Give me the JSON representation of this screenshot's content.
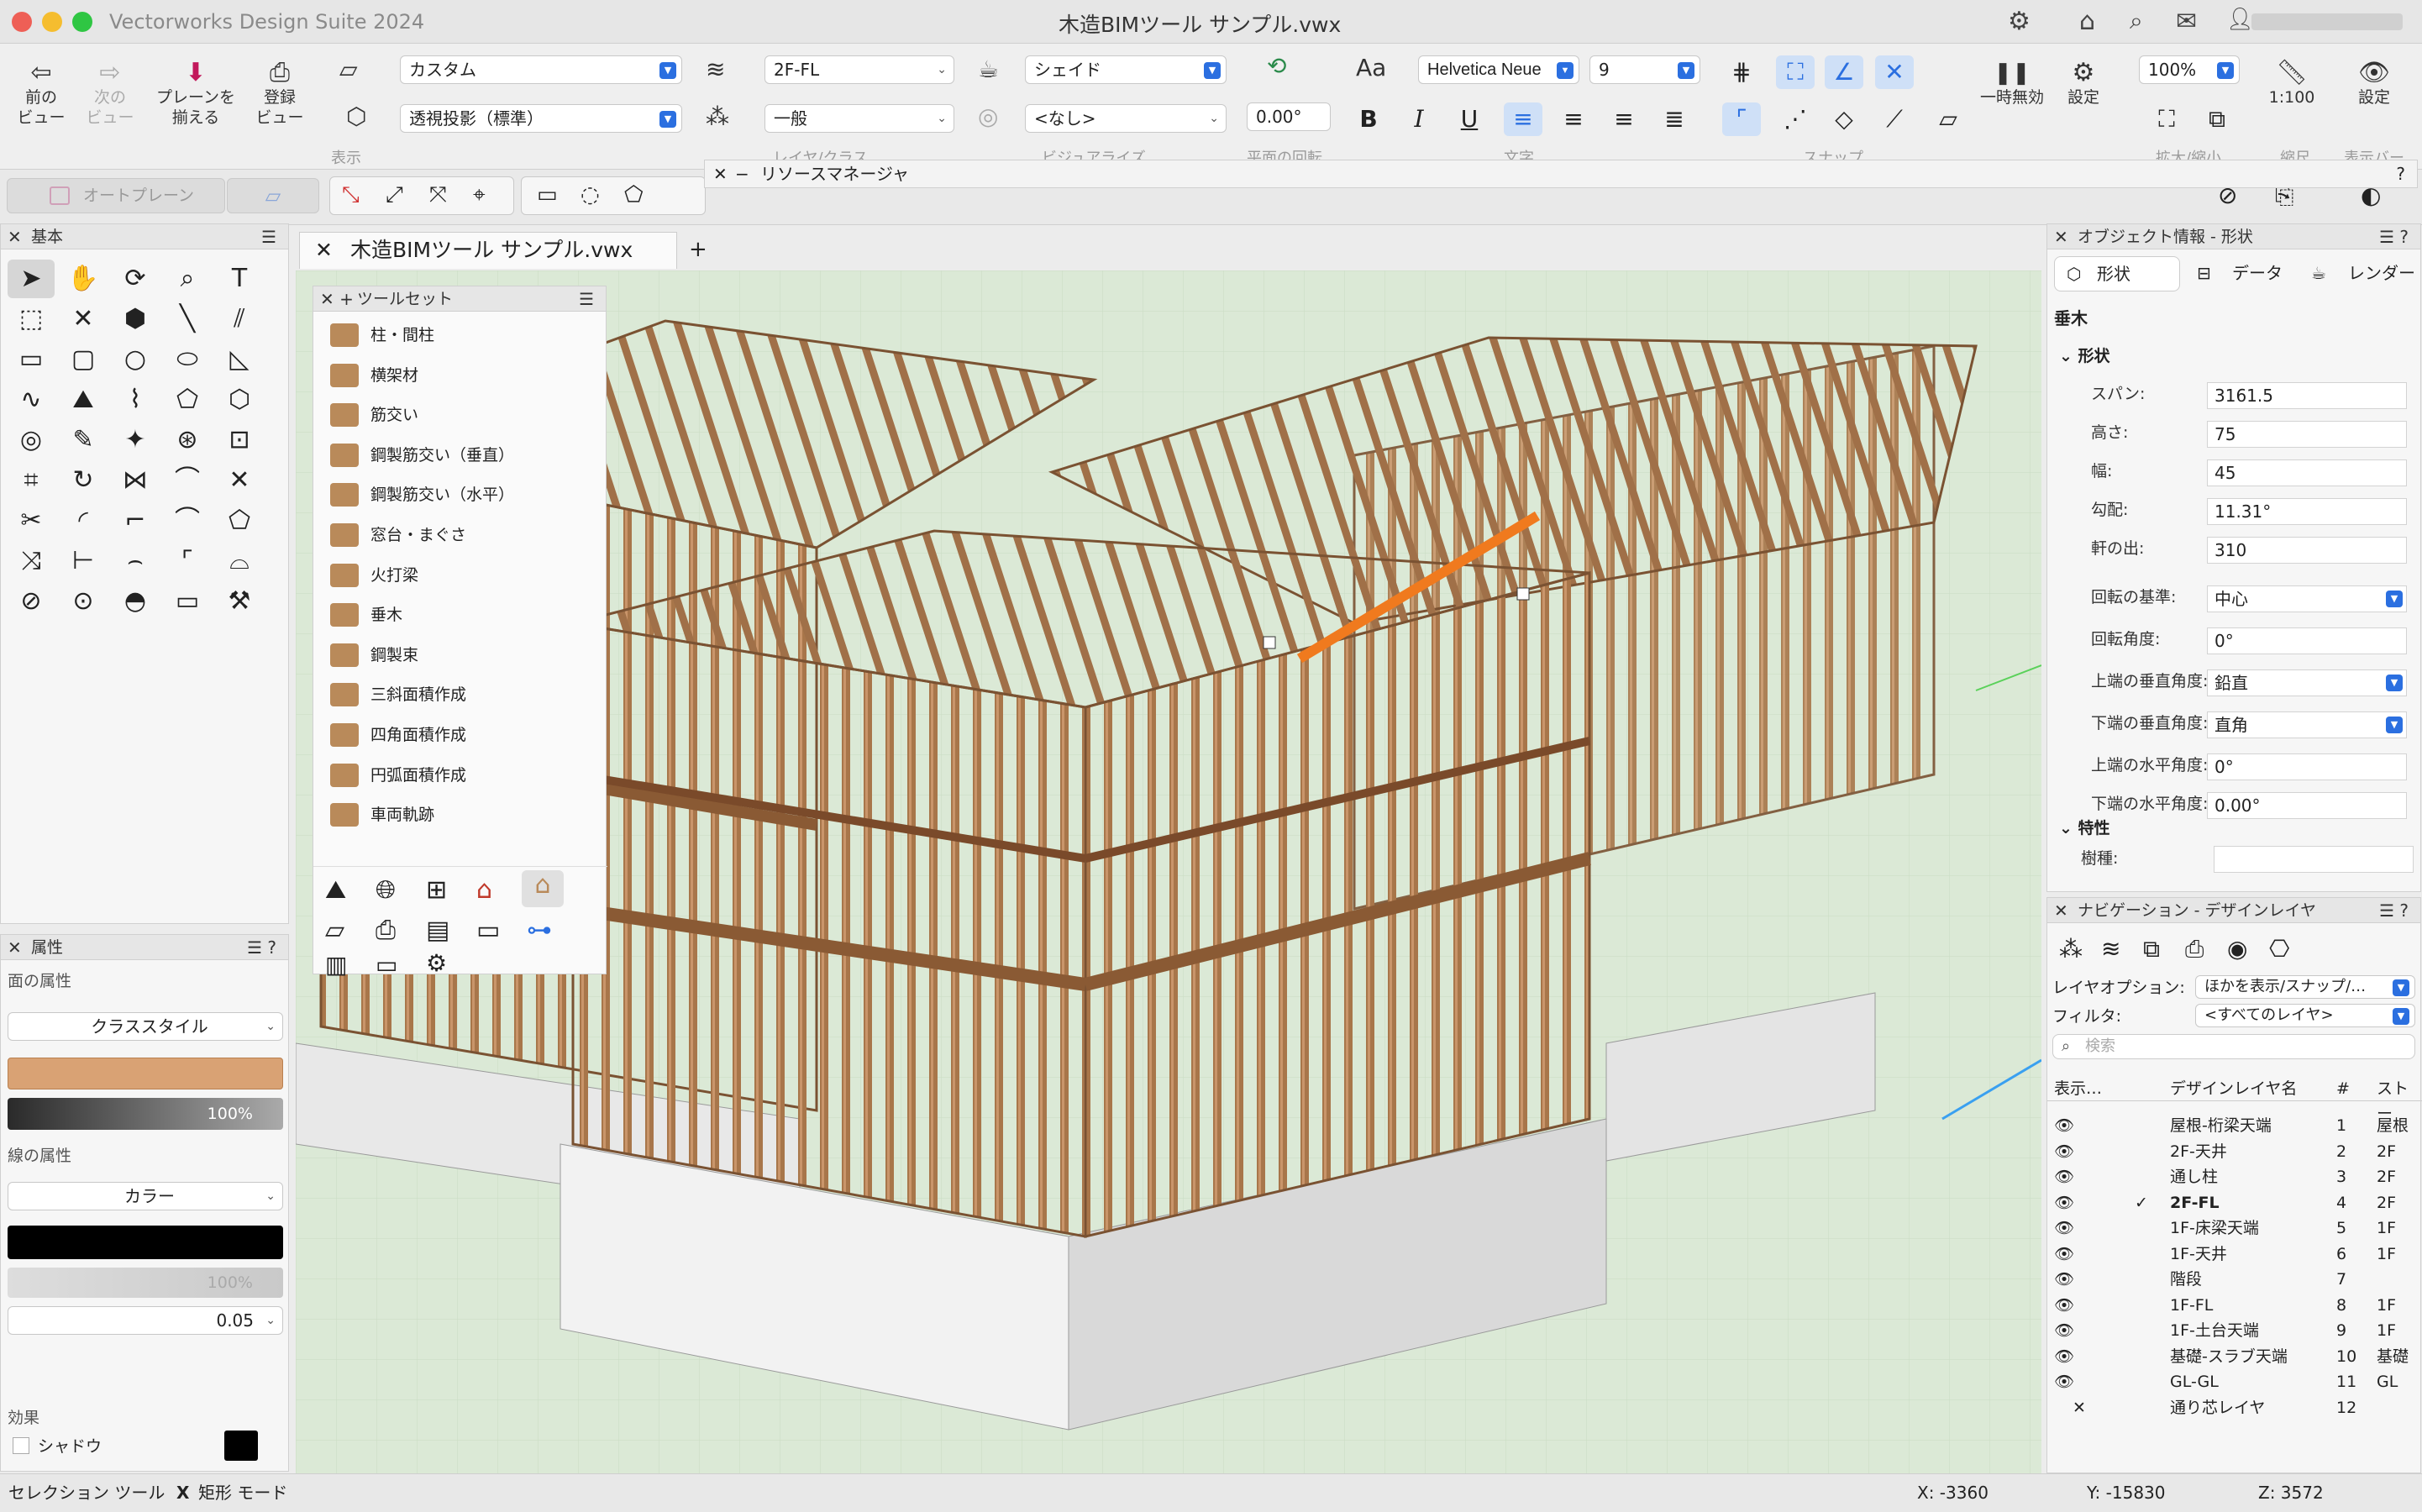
{
  "window": {
    "app_name": "Vectorworks Design Suite 2024",
    "doc_title": "木造BIMツール サンプル.vwx"
  },
  "toolbar": {
    "prev_view": "前の\nビュー",
    "next_view": "次の\nビュー",
    "align_plane": "プレーンを\n揃える",
    "saved_view": "登録\nビュー",
    "plane_select": "カスタム",
    "projection_select": "透視投影（標準）",
    "group_view": "表示",
    "layer_select": "2F-FL",
    "class_select": "一般",
    "group_layer": "レイヤ/クラス",
    "render_select": "シェイド",
    "light_select": "<なし>",
    "group_visualize": "ビジュアライズ",
    "rotation_value": "0.00°",
    "group_rotation": "平面の回転",
    "font_select": "Helvetica Neue",
    "size_select": "9",
    "group_text": "文字",
    "group_snap": "スナップ",
    "pause_label": "一時無効",
    "settings_label": "設定",
    "zoom_select": "100%",
    "group_zoom": "拡大/縮小",
    "scale_label": "1:100",
    "group_scale": "縮尺",
    "display_settings": "設定",
    "group_display": "表示バー"
  },
  "rowbar": {
    "auto_plane": "オートプレーン"
  },
  "resource_manager": {
    "title": "リソースマネージャ"
  },
  "basic_palette": {
    "title": "基本"
  },
  "tab": {
    "label": "木造BIMツール サンプル.vwx",
    "add": "+"
  },
  "toolset": {
    "title": "ツールセット",
    "items": [
      "柱・間柱",
      "横架材",
      "筋交い",
      "鋼製筋交い（垂直）",
      "鋼製筋交い（水平）",
      "窓台・まぐさ",
      "火打梁",
      "垂木",
      "鋼製束",
      "三斜面積作成",
      "四角面積作成",
      "円弧面積作成",
      "車両軌跡"
    ]
  },
  "attributes": {
    "title": "属性",
    "face_label": "面の属性",
    "face_style": "クラススタイル",
    "face_opacity": "100%",
    "line_label": "線の属性",
    "line_style": "カラー",
    "line_opacity": "100%",
    "line_weight": "0.05",
    "effects_label": "効果",
    "shadow_label": "シャドウ",
    "face_color": "#d9a274",
    "line_color": "#000000"
  },
  "object_info": {
    "title": "オブジェクト情報 - 形状",
    "tabs": [
      "形状",
      "データ",
      "レンダー"
    ],
    "object_name": "垂木",
    "section_shape": "形状",
    "fields": [
      {
        "label": "スパン:",
        "value": "3161.5"
      },
      {
        "label": "高さ:",
        "value": "75"
      },
      {
        "label": "幅:",
        "value": "45"
      },
      {
        "label": "勾配:",
        "value": "11.31°"
      },
      {
        "label": "軒の出:",
        "value": "310"
      },
      {
        "label": "回転の基準:",
        "value": "中心"
      },
      {
        "label": "回転角度:",
        "value": "0°"
      },
      {
        "label": "上端の垂直角度:",
        "value": "鉛直"
      },
      {
        "label": "下端の垂直角度:",
        "value": "直角"
      },
      {
        "label": "上端の水平角度:",
        "value": "0°"
      },
      {
        "label": "下端の水平角度:",
        "value": "0.00°"
      }
    ],
    "section_props": "特性",
    "species_label": "樹種:",
    "species_value": ""
  },
  "navigation": {
    "title": "ナビゲーション - デザインレイヤ",
    "layer_option_label": "レイヤオプション:",
    "layer_option_value": "ほかを表示/スナップ/…",
    "filter_label": "フィルタ:",
    "filter_value": "<すべてのレイヤ>",
    "search_placeholder": "検索",
    "col_visibility": "表示…",
    "col_name": "デザインレイヤ名",
    "col_num": "#",
    "col_story": "ストー",
    "layers": [
      {
        "name": "屋根-桁梁天端",
        "num": "1",
        "story": "屋根"
      },
      {
        "name": "2F-天井",
        "num": "2",
        "story": "2F"
      },
      {
        "name": "通し柱",
        "num": "3",
        "story": "2F"
      },
      {
        "name": "2F-FL",
        "num": "4",
        "story": "2F",
        "active": true
      },
      {
        "name": "1F-床梁天端",
        "num": "5",
        "story": "1F"
      },
      {
        "name": "1F-天井",
        "num": "6",
        "story": "1F"
      },
      {
        "name": "階段",
        "num": "7",
        "story": ""
      },
      {
        "name": "1F-FL",
        "num": "8",
        "story": "1F"
      },
      {
        "name": "1F-土台天端",
        "num": "9",
        "story": "1F"
      },
      {
        "name": "基礎-スラブ天端",
        "num": "10",
        "story": "基礎"
      },
      {
        "name": "GL-GL",
        "num": "11",
        "story": "GL"
      },
      {
        "name": "通り芯レイヤ",
        "num": "12",
        "story": ""
      }
    ]
  },
  "status": {
    "tool": "セレクション ツール",
    "mode": "矩形 モード",
    "x": "X: -3360",
    "y": "Y: -15830",
    "z": "Z: 3572"
  }
}
